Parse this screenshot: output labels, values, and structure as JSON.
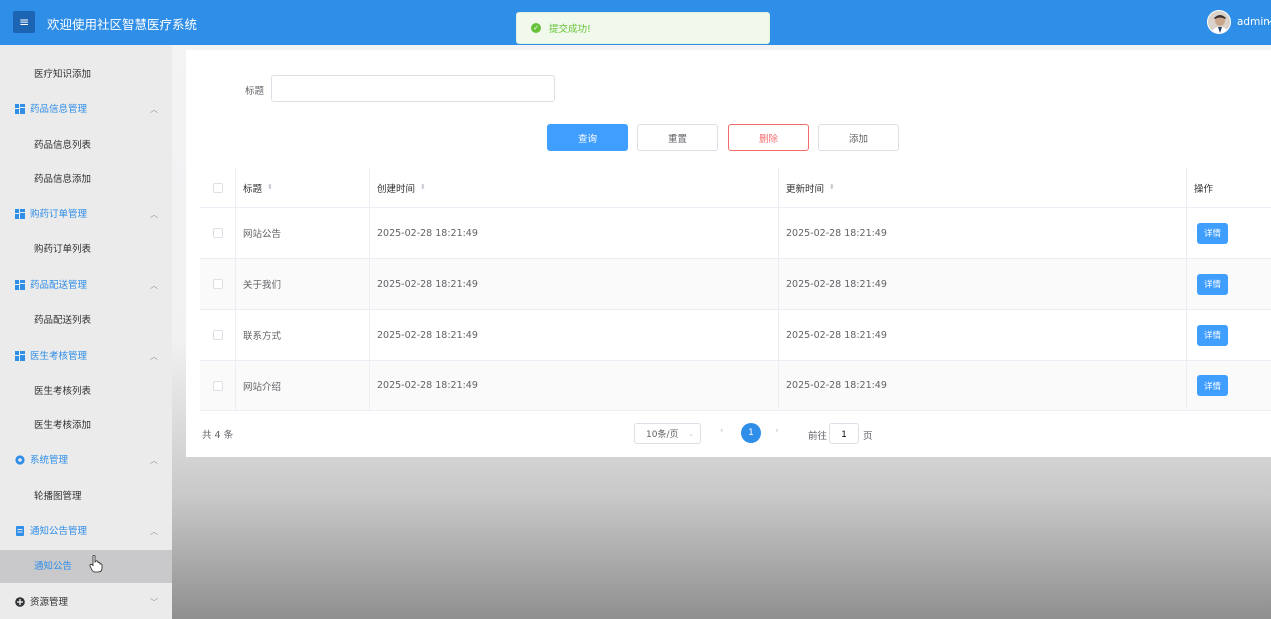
{
  "header": {
    "menu_icon": "≡",
    "title": "欢迎使用社区智慧医疗系统",
    "user": "admin"
  },
  "toast": {
    "message": "提交成功!"
  },
  "sidebar": {
    "items": [
      {
        "type": "sub",
        "label": "医疗知识添加"
      },
      {
        "type": "group",
        "label": "药品信息管理",
        "icon": "grid-icon"
      },
      {
        "type": "sub",
        "label": "药品信息列表"
      },
      {
        "type": "sub",
        "label": "药品信息添加"
      },
      {
        "type": "group",
        "label": "购药订单管理",
        "icon": "grid-icon"
      },
      {
        "type": "sub",
        "label": "购药订单列表"
      },
      {
        "type": "group",
        "label": "药品配送管理",
        "icon": "grid-icon"
      },
      {
        "type": "sub",
        "label": "药品配送列表"
      },
      {
        "type": "group",
        "label": "医生考核管理",
        "icon": "grid-icon"
      },
      {
        "type": "sub",
        "label": "医生考核列表"
      },
      {
        "type": "sub",
        "label": "医生考核添加"
      },
      {
        "type": "group",
        "label": "系统管理",
        "icon": "gear-icon"
      },
      {
        "type": "sub",
        "label": "轮播图管理"
      },
      {
        "type": "group",
        "label": "通知公告管理",
        "icon": "document-icon"
      },
      {
        "type": "sub",
        "label": "通知公告",
        "active": true
      },
      {
        "type": "group",
        "label": "资源管理",
        "icon": "plus-circle-icon"
      }
    ]
  },
  "search": {
    "label": "标题",
    "value": "",
    "placeholder": ""
  },
  "buttons": {
    "query": "查询",
    "reset": "重置",
    "delete": "删除",
    "add": "添加"
  },
  "table": {
    "headers": {
      "title": "标题",
      "created": "创建时间",
      "updated": "更新时间",
      "op": "操作"
    },
    "rows": [
      {
        "title": "网站公告",
        "created": "2025-02-28 18:21:49",
        "updated": "2025-02-28 18:21:49",
        "action": "详情"
      },
      {
        "title": "关于我们",
        "created": "2025-02-28 18:21:49",
        "updated": "2025-02-28 18:21:49",
        "action": "详情"
      },
      {
        "title": "联系方式",
        "created": "2025-02-28 18:21:49",
        "updated": "2025-02-28 18:21:49",
        "action": "详情"
      },
      {
        "title": "网站介绍",
        "created": "2025-02-28 18:21:49",
        "updated": "2025-02-28 18:21:49",
        "action": "详情"
      }
    ]
  },
  "pagination": {
    "total": "共 4 条",
    "page_size": "10条/页",
    "current": "1",
    "goto_prefix": "前往",
    "goto_value": "1",
    "goto_suffix": "页"
  },
  "colors": {
    "primary": "#2f8ee8",
    "button": "#409eff",
    "danger": "#f56c6c",
    "success": "#67c23a"
  }
}
